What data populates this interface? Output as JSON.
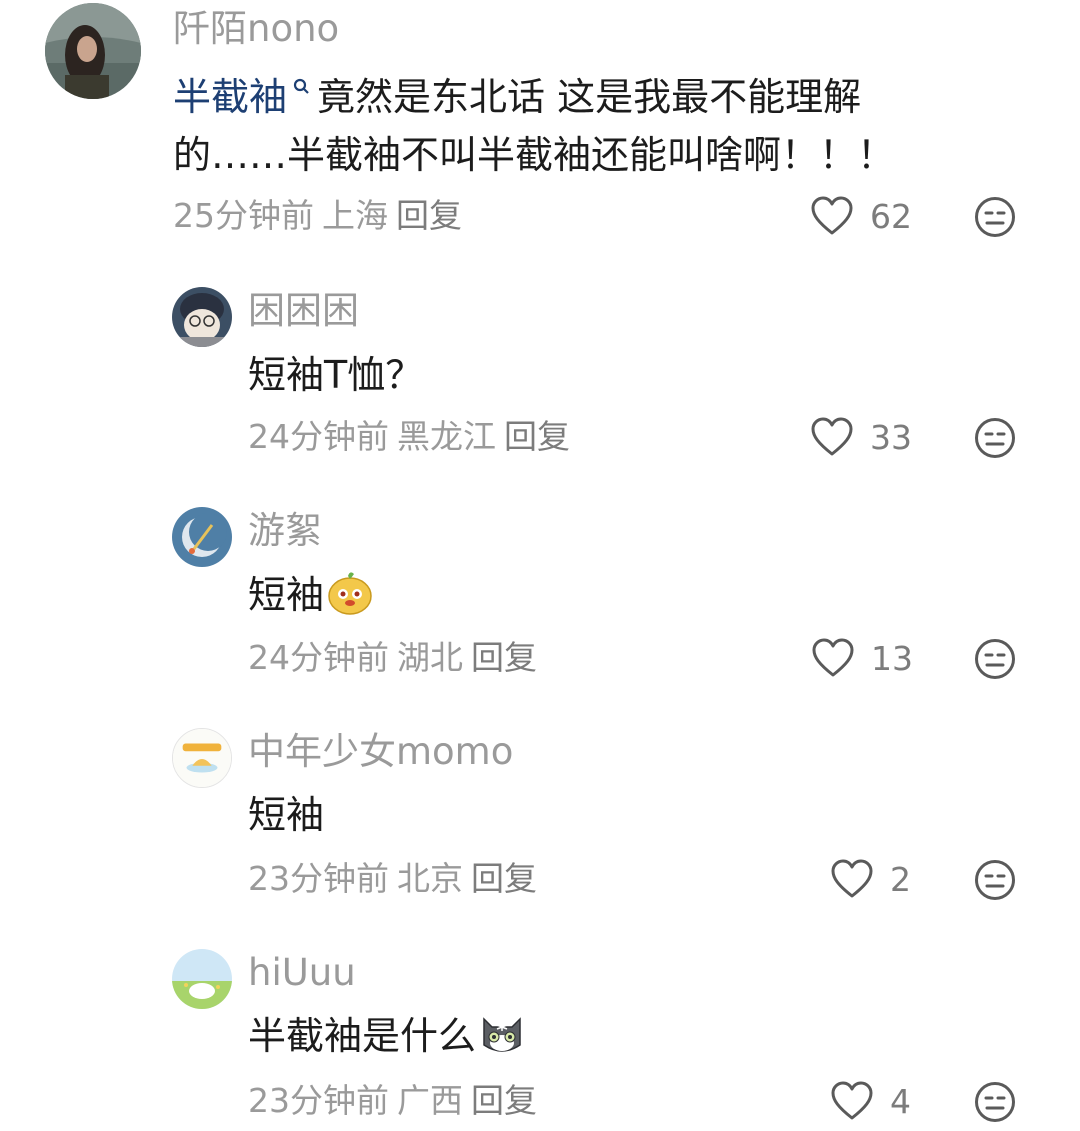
{
  "comments": [
    {
      "username": "阡陌nono",
      "keyword": "半截袖",
      "text_line1": "竟然是东北话 这是我最不能理解",
      "text_line2": "的……半截袖不叫半截袖还能叫啥啊！！！",
      "time": "25分钟前",
      "location": "上海",
      "reply_label": "回复",
      "likes": "62"
    },
    {
      "username": "困困困",
      "text": "短袖T恤？",
      "time": "24分钟前",
      "location": "黑龙江",
      "reply_label": "回复",
      "likes": "33"
    },
    {
      "username": "游絮",
      "text": "短袖",
      "emoji": "yellow-cartoon-face-emoji",
      "time": "24分钟前",
      "location": "湖北",
      "reply_label": "回复",
      "likes": "13"
    },
    {
      "username": "中年少女momo",
      "text": "短袖",
      "time": "23分钟前",
      "location": "北京",
      "reply_label": "回复",
      "likes": "2"
    },
    {
      "username": "hiUuu",
      "text": "半截袖是什么",
      "emoji": "cat-face-emoji",
      "time": "23分钟前",
      "location": "广西",
      "reply_label": "回复",
      "likes": "4"
    }
  ],
  "colors": {
    "keyword": "#1d3f73",
    "meta": "#9a9a9a",
    "text": "#1c1c1c"
  }
}
